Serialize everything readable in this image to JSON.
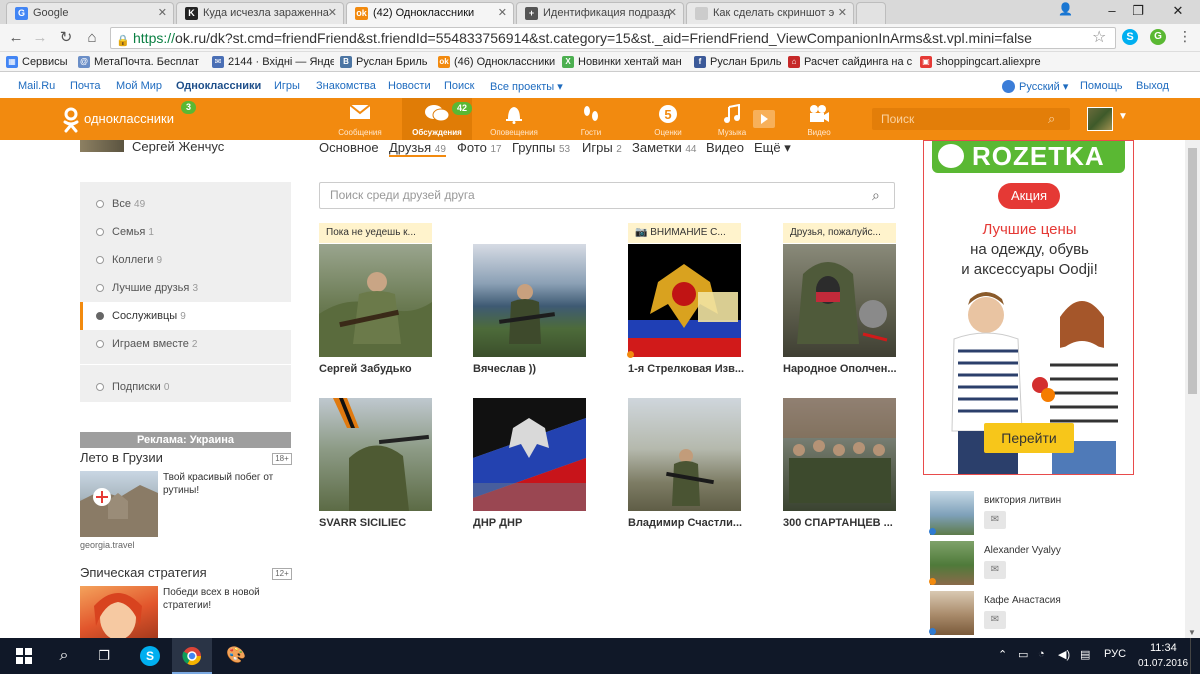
{
  "browser": {
    "tabs": [
      {
        "label": "Google",
        "icon": "google-icon",
        "color": "#4285f4",
        "glyph": "G"
      },
      {
        "label": "Куда исчезла зараженна",
        "icon": "kp-icon",
        "color": "#222222",
        "glyph": "K"
      },
      {
        "label": "(42) Одноклассники",
        "icon": "ok-icon",
        "color": "#f28a0f",
        "glyph": "OK",
        "active": true
      },
      {
        "label": "Идентификация подразд",
        "icon": "crosshair-icon",
        "color": "#555555",
        "glyph": "+"
      },
      {
        "label": "Как сделать скриншот э",
        "icon": "page-icon",
        "color": "#bbbbbb",
        "glyph": ""
      }
    ],
    "window_controls": [
      "–",
      "❐",
      "✕"
    ],
    "url_scheme": "https://",
    "url_rest": "ok.ru/dk?st.cmd=friendFriend&st.friendId=554833756914&st.category=15&st._aid=FriendFriend_ViewCompanionInArms&st.vpl.mini=false",
    "bookmarks": [
      {
        "label": "Сервисы",
        "color": "#4285f4",
        "glyph": "▦"
      },
      {
        "label": "МетаПочта. Бесплат",
        "color": "#6a8ec7",
        "glyph": "@"
      },
      {
        "label": "2144 · Вхідні — Янде",
        "color": "#4a6fb5",
        "glyph": "✉"
      },
      {
        "label": "Руслан Бриль",
        "color": "#4c75a3",
        "glyph": "B"
      },
      {
        "label": "(46) Одноклассники",
        "color": "#f28a0f",
        "glyph": "OK"
      },
      {
        "label": "Новинки хентай ман",
        "color": "#4caf50",
        "glyph": "X"
      },
      {
        "label": "Руслан Бриль",
        "color": "#3b5998",
        "glyph": "f"
      },
      {
        "label": "Расчет сайдинга на с",
        "color": "#c62828",
        "glyph": "⌂"
      },
      {
        "label": "shoppingcart.aliexpre",
        "color": "#e53935",
        "glyph": "▣"
      }
    ]
  },
  "portal": {
    "links": [
      "Mail.Ru",
      "Почта",
      "Мой Мир",
      "Одноклассники",
      "Игры",
      "Знакомства",
      "Новости",
      "Поиск",
      "Все проекты ▾"
    ],
    "language": "Русский ▾",
    "help": "Помощь",
    "exit": "Выход"
  },
  "ok": {
    "logo_text": "одноклассники",
    "logo_badge": "3",
    "menu": [
      {
        "label": "Сообщения",
        "icon": "envelope-icon",
        "glyph": "✉"
      },
      {
        "label": "Обсуждения",
        "icon": "discussions-icon",
        "glyph": "💬",
        "badge": "42",
        "active": true
      },
      {
        "label": "Оповещения",
        "icon": "bell-icon",
        "glyph": "🔔"
      },
      {
        "label": "Гости",
        "icon": "footprints-icon",
        "glyph": "👣"
      },
      {
        "label": "Оценки",
        "icon": "rating-icon",
        "glyph": "5"
      },
      {
        "label": "Музыка",
        "icon": "music-note-icon",
        "glyph": "♫"
      },
      {
        "label": "Видео",
        "icon": "video-camera-icon",
        "glyph": "🎥"
      }
    ],
    "search_placeholder": "Поиск",
    "accent": "#f28a0f"
  },
  "profile": {
    "name": "Сергей Женчус",
    "tabs": [
      {
        "label": "Основное",
        "count": ""
      },
      {
        "label": "Друзья",
        "count": "49",
        "active": true
      },
      {
        "label": "Фото",
        "count": "17"
      },
      {
        "label": "Группы",
        "count": "53"
      },
      {
        "label": "Игры",
        "count": "2"
      },
      {
        "label": "Заметки",
        "count": "44"
      },
      {
        "label": "Видео",
        "count": ""
      },
      {
        "label": "Ещё ▾",
        "count": ""
      }
    ]
  },
  "left_menu": [
    {
      "label": "Все",
      "count": "49"
    },
    {
      "label": "Семья",
      "count": "1"
    },
    {
      "label": "Коллеги",
      "count": "9"
    },
    {
      "label": "Лучшие друзья",
      "count": "3"
    },
    {
      "label": "Сослуживцы",
      "count": "9",
      "active": true
    },
    {
      "label": "Играем вместе",
      "count": "2"
    },
    {
      "label": "Подписки",
      "count": "0"
    }
  ],
  "ads_left": {
    "header": "Реклама: Украина",
    "items": [
      {
        "title": "Лето в Грузии",
        "age": "18+",
        "text": "Твой красивый побег от рутины!",
        "source": "georgia.travel"
      },
      {
        "title": "Эпическая стратегия",
        "age": "12+",
        "text": "Победи всех в новой стратегии!",
        "source": ""
      }
    ]
  },
  "friends": {
    "search_placeholder": "Поиск среди друзей друга",
    "cards": [
      {
        "name": "Сергей Забудько",
        "tag": "Пока не уедешь к...",
        "camera": false
      },
      {
        "name": "Вячеслав ))",
        "tag": "",
        "camera": false
      },
      {
        "name": "1-я Стрелковая Изв...",
        "tag": "ВНИМАНИЕ С...",
        "camera": true
      },
      {
        "name": "Народное Ополчен...",
        "tag": "Друзья, пожалуйс...",
        "camera": false
      },
      {
        "name": "SVARR SICILIEC",
        "tag": "",
        "camera": false
      },
      {
        "name": "ДНР ДНР",
        "tag": "",
        "camera": false
      },
      {
        "name": "Владимир Счастли...",
        "tag": "",
        "camera": false
      },
      {
        "name": "300 СПАРТАНЦЕВ ...",
        "tag": "",
        "camera": false
      }
    ]
  },
  "right_ad": {
    "brand": "ROZETKA",
    "badge": "Акция",
    "headline": "Лучшие цены",
    "line2": "на одежду, обувь",
    "line3": "и аксессуары Oodji!",
    "cta": "Перейти"
  },
  "suggestions": [
    {
      "name": "виктория литвин"
    },
    {
      "name": "Alexander Vyalyy"
    },
    {
      "name": "Кафе Анастасия"
    }
  ],
  "taskbar": {
    "lang": "РУС",
    "time": "11:34",
    "date": "01.07.2016"
  }
}
